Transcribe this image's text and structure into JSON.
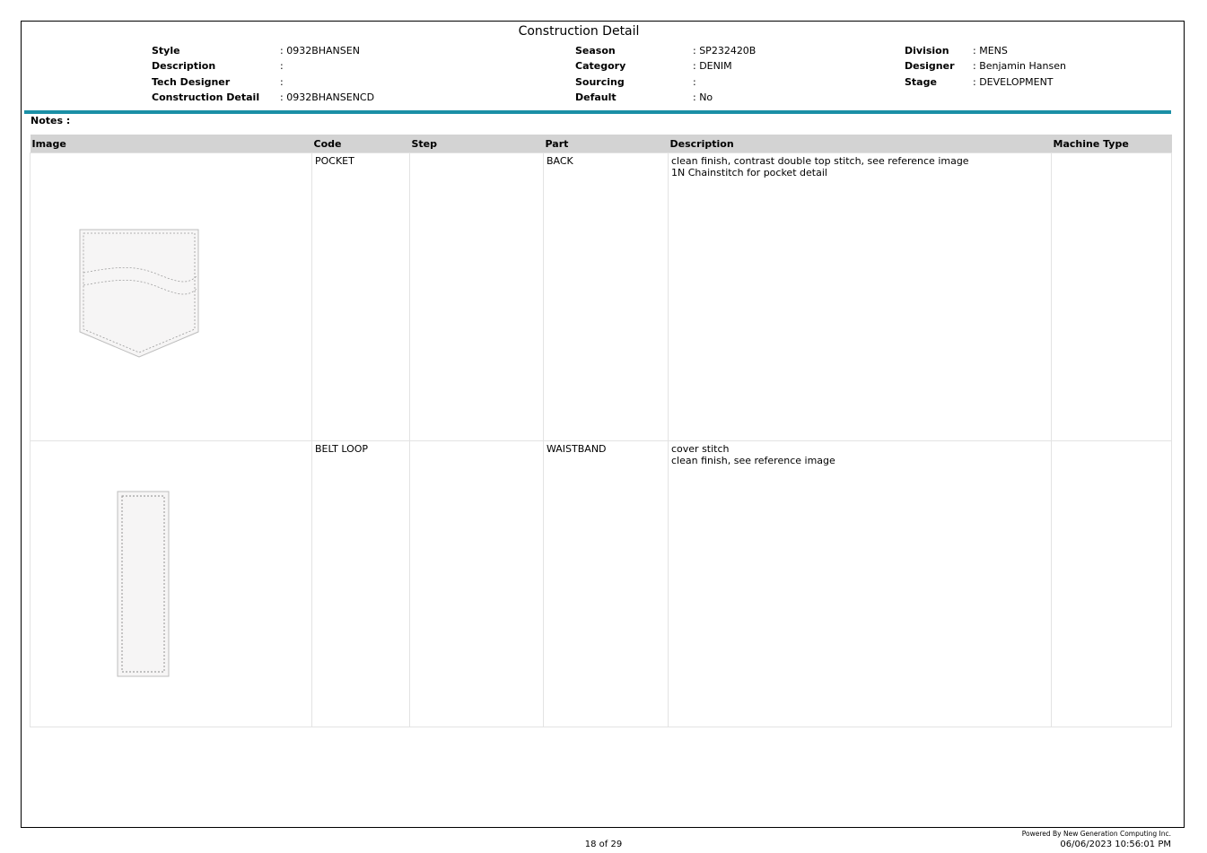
{
  "title": "Construction Detail",
  "header": {
    "col1": [
      {
        "label": "Style",
        "value": ": 0932BHANSEN"
      },
      {
        "label": "Description",
        "value": ":"
      },
      {
        "label": "Tech Designer",
        "value": ":"
      },
      {
        "label": "Construction Detail",
        "value": ": 0932BHANSENCD"
      }
    ],
    "col2": [
      {
        "label": "Season",
        "value": ":  SP232420B"
      },
      {
        "label": "Category",
        "value": ":  DENIM"
      },
      {
        "label": "Sourcing",
        "value": ":"
      },
      {
        "label": "Default",
        "value": ":  No"
      }
    ],
    "col3": [
      {
        "label": "Division",
        "value": ": MENS"
      },
      {
        "label": "Designer",
        "value": ": Benjamin Hansen"
      },
      {
        "label": "Stage",
        "value": ": DEVELOPMENT"
      }
    ]
  },
  "notes_label": "Notes :",
  "table": {
    "headers": [
      "Image",
      "Code",
      "Step",
      "Part",
      "Description",
      "Machine Type"
    ],
    "rows": [
      {
        "image": "back-pocket-sketch",
        "code": "POCKET",
        "step": "",
        "part": "BACK",
        "description": [
          "clean finish, contrast double top stitch, see reference image",
          "1N Chainstitch for pocket detail"
        ],
        "machine_type": ""
      },
      {
        "image": "belt-loop-sketch",
        "code": "BELT LOOP",
        "step": "",
        "part": "WAISTBAND",
        "description": [
          "cover stitch",
          "clean finish, see reference image"
        ],
        "machine_type": ""
      }
    ]
  },
  "footer": {
    "page": "18 of 29",
    "powered_by": "Powered By New Generation Computing Inc.",
    "timestamp": "06/06/2023 10:56:01 PM"
  }
}
